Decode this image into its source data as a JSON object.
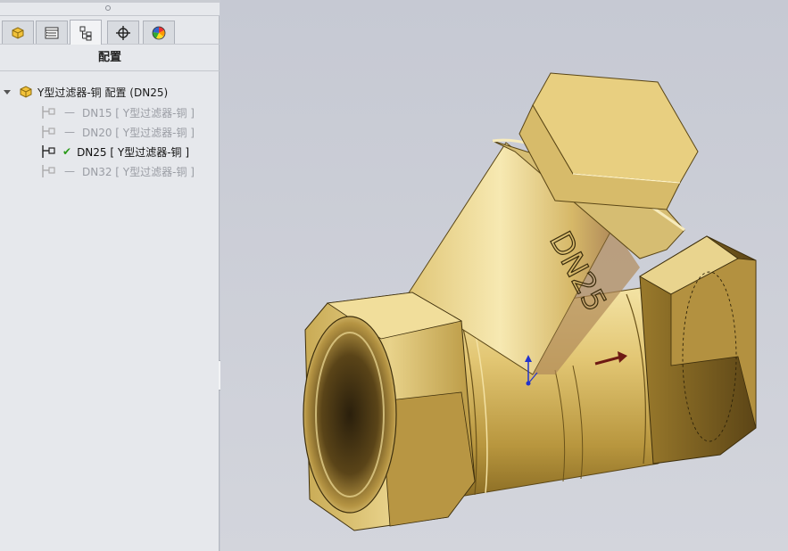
{
  "panel": {
    "title": "配置",
    "tabs": [
      {
        "name": "feature-manager-tab",
        "icon": "part-icon"
      },
      {
        "name": "property-manager-tab",
        "icon": "property-list-icon"
      },
      {
        "name": "configuration-manager-tab",
        "icon": "configuration-icon"
      },
      {
        "name": "dimxpert-tab",
        "icon": "crosshair-icon"
      },
      {
        "name": "display-manager-tab",
        "icon": "color-wheel-icon"
      }
    ],
    "active_tab": 2
  },
  "tree": {
    "root_label": "Y型过滤器-铜 配置  (DN25)",
    "configs": [
      {
        "prefix": "—",
        "label": "DN15 [ Y型过滤器-铜 ]",
        "active": false
      },
      {
        "prefix": "—",
        "label": "DN20 [ Y型过滤器-铜 ]",
        "active": false
      },
      {
        "prefix": "✔",
        "label": "DN25 [ Y型过滤器-铜 ]",
        "active": true
      },
      {
        "prefix": "—",
        "label": "DN32 [ Y型过滤器-铜 ]",
        "active": false
      }
    ]
  },
  "model": {
    "engraving": "DN25",
    "colors": {
      "brass_light": "#f1dd96",
      "brass_mid": "#d8bc62",
      "brass_dark": "#8a6c24",
      "arrow": "#6e1a14"
    }
  }
}
